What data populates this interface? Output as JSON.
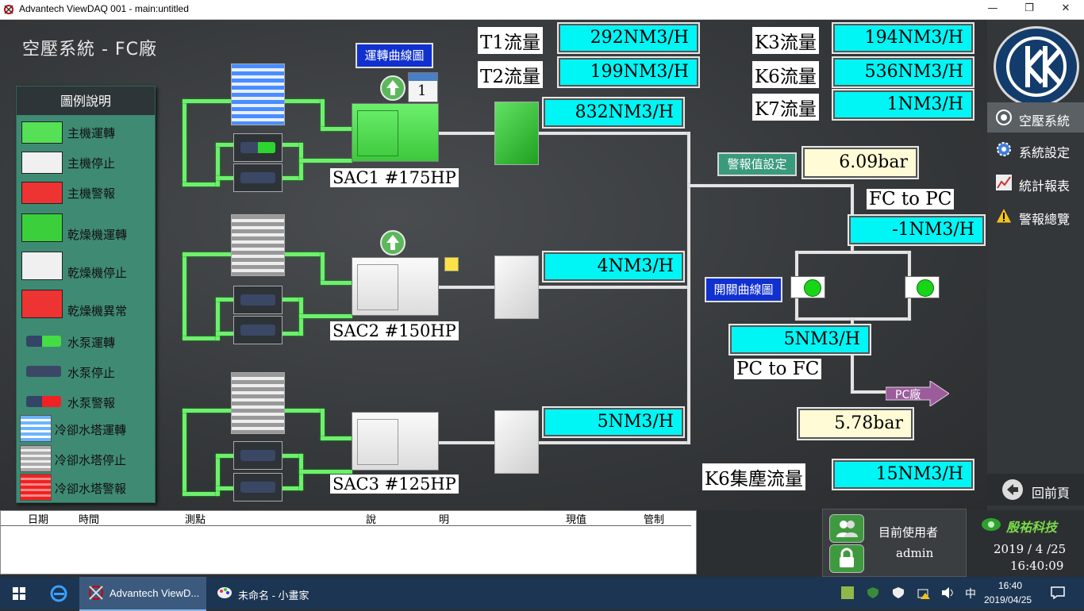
{
  "window": {
    "title": "Advantech ViewDAQ 001 - main:untitled"
  },
  "page": {
    "heading": "空壓系統 - FC廠"
  },
  "legend": {
    "title": "圖例說明",
    "items": [
      "主機運轉",
      "主機停止",
      "主機警報",
      "乾燥機運轉",
      "乾燥機停止",
      "乾燥機異常",
      "水泵運轉",
      "水泵停止",
      "水泵警報",
      "冷卻水塔運轉",
      "冷卻水塔停止",
      "冷卻水塔警報"
    ]
  },
  "buttons": {
    "run_curve": "運轉曲線圖",
    "alarm_setting": "警報值設定",
    "switch_curve": "開關曲線圖",
    "pc_plant": "PC廠"
  },
  "badge": {
    "calendar_num": "1"
  },
  "units": {
    "sac1": {
      "label": "SAC1 #175HP",
      "flow": "832NM3/H"
    },
    "sac2": {
      "label": "SAC2 #150HP",
      "flow": "4NM3/H"
    },
    "sac3": {
      "label": "SAC3 #125HP",
      "flow": "5NM3/H"
    }
  },
  "flows": {
    "t1_label": "T1流量",
    "t1_value": "292NM3/H",
    "t2_label": "T2流量",
    "t2_value": "199NM3/H",
    "k3_label": "K3流量",
    "k3_value": "194NM3/H",
    "k6_label": "K6流量",
    "k6_value": "536NM3/H",
    "k7_label": "K7流量",
    "k7_value": "1NM3/H",
    "k6_dust_label": "K6集塵流量",
    "k6_dust_value": "15NM3/H"
  },
  "pressure": {
    "main": "6.09bar",
    "pc": "5.78bar"
  },
  "transfer": {
    "fc_to_pc_label": "FC to PC",
    "fc_to_pc_value": "-1NM3/H",
    "pc_to_fc_label": "PC to FC",
    "pc_to_fc_value": "5NM3/H"
  },
  "nav": {
    "items": [
      "空壓系統",
      "系統設定",
      "統計報表",
      "警報總覽"
    ],
    "back": "回前頁"
  },
  "log": {
    "columns": [
      "日期",
      "時間",
      "測點",
      "說",
      "明",
      "現值",
      "管制"
    ]
  },
  "user": {
    "label": "目前使用者",
    "name": "admin"
  },
  "brand": {
    "name": "殷祐科技"
  },
  "clock": {
    "date": "2019 / 4 /25",
    "time": "16:40:09"
  },
  "taskbar": {
    "apps": [
      "Advantech ViewD...",
      "未命名 - 小畫家"
    ],
    "tray_ime": "中",
    "time": "16:40",
    "date": "2019/04/25"
  },
  "colors": {
    "running": "#55e055",
    "stopped": "#f0f0f0",
    "alarm": "#e33",
    "display": "#00f5f5",
    "pressure_bg": "#fffbd6",
    "button_blue": "#1030d0"
  }
}
